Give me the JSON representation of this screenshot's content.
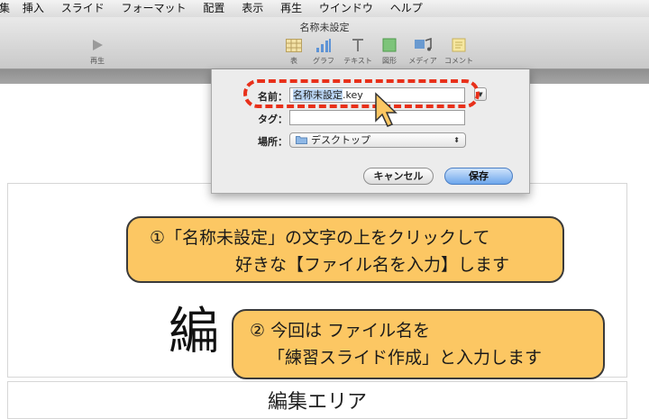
{
  "menubar": {
    "items": [
      "集",
      "挿入",
      "スライド",
      "フォーマット",
      "配置",
      "表示",
      "再生",
      "ウインドウ",
      "ヘルプ"
    ]
  },
  "window": {
    "title": "名称未設定"
  },
  "toolbar": {
    "play_label": "再生",
    "tools": [
      {
        "label": "表",
        "icon": "table-icon"
      },
      {
        "label": "グラフ",
        "icon": "chart-icon"
      },
      {
        "label": "テキスト",
        "icon": "text-icon"
      },
      {
        "label": "図形",
        "icon": "shape-icon"
      },
      {
        "label": "メディア",
        "icon": "media-icon"
      },
      {
        "label": "コメント",
        "icon": "comment-icon"
      }
    ]
  },
  "save_dialog": {
    "name_label": "名前：",
    "name_value_selected": "名称未設定",
    "name_value_ext": ".key",
    "tag_label": "タグ：",
    "tag_value": "",
    "location_label": "場所：",
    "location_value": "デスクトップ",
    "cancel_label": "キャンセル",
    "save_label": "保存"
  },
  "slide": {
    "title_partial": "編",
    "body_text": "編集エリア"
  },
  "callouts": {
    "first_line1": "①「名称未設定」の文字の上をクリックして",
    "first_line2": "好きな【ファイル名を入力】します",
    "second_line1": "② 今回は ファイル名を",
    "second_line2": "「練習スライド作成」と入力します"
  },
  "colors": {
    "callout_fill": "#fcc763",
    "highlight_dash": "#e8301a",
    "save_button": "#6da6ec",
    "selection": "#b9d4f3"
  }
}
